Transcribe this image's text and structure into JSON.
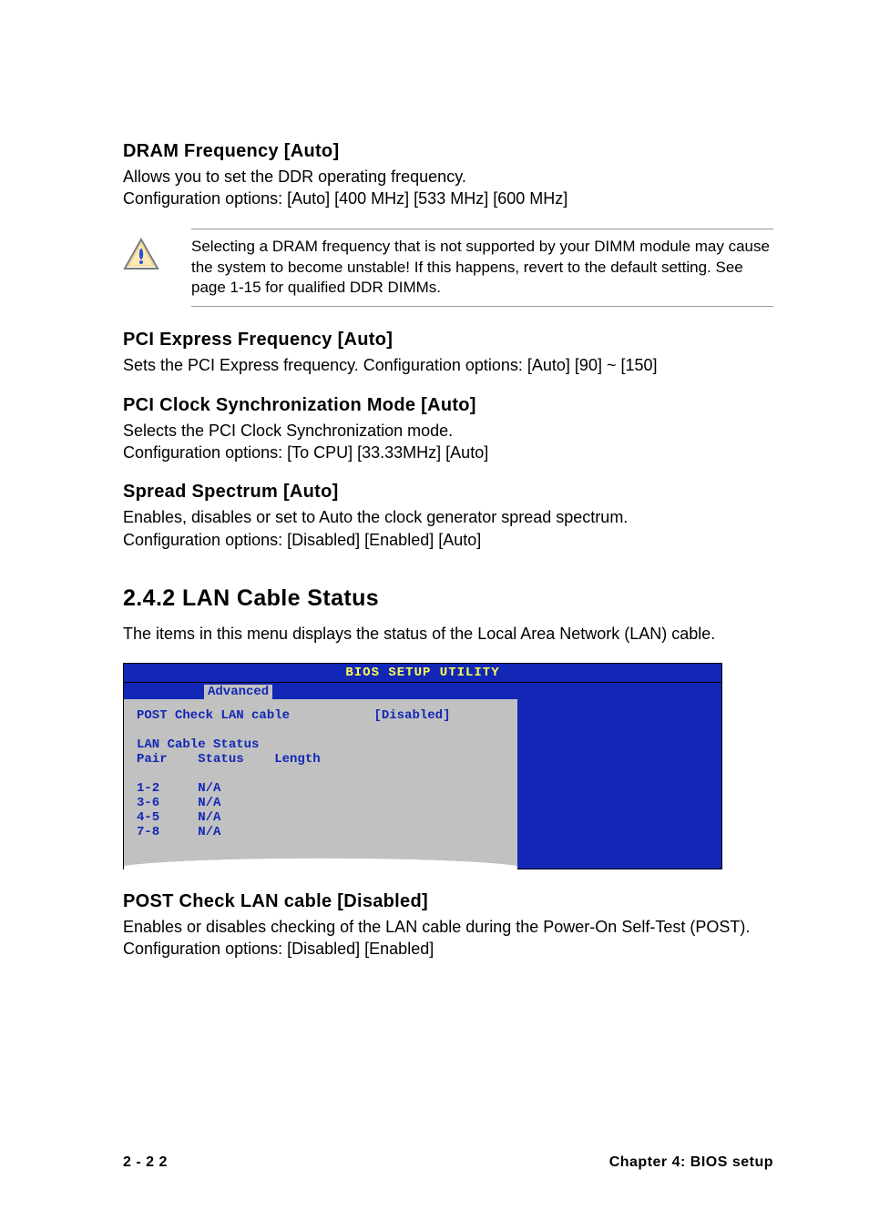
{
  "sections": {
    "dram": {
      "heading": "DRAM Frequency [Auto]",
      "text": "Allows you to set the DDR operating frequency.\nConfiguration options: [Auto] [400 MHz] [533 MHz] [600 MHz]"
    },
    "note": "Selecting a DRAM frequency that is not supported by your DIMM module may cause the system to become unstable! If this happens, revert to the default setting. See page 1-15 for qualified DDR DIMMs.",
    "pci_express": {
      "heading": "PCI Express Frequency [Auto]",
      "text": "Sets the PCI Express frequency. Configuration options: [Auto] [90] ~ [150]"
    },
    "pci_clock": {
      "heading": "PCI Clock Synchronization Mode [Auto]",
      "text": "Selects the PCI Clock Synchronization mode.\nConfiguration options: [To CPU] [33.33MHz] [Auto]"
    },
    "spread": {
      "heading": "Spread Spectrum [Auto]",
      "text": "Enables, disables or set to Auto the clock generator spread spectrum.\nConfiguration options: [Disabled] [Enabled] [Auto]"
    },
    "lan_status": {
      "heading": "2.4.2   LAN Cable Status",
      "text": "The items in this menu displays the status of the Local Area Network (LAN) cable."
    },
    "post_check": {
      "heading": "POST Check LAN cable [Disabled]",
      "text": "Enables or disables checking of the LAN cable during the Power-On Self-Test (POST). Configuration options: [Disabled] [Enabled]"
    }
  },
  "bios": {
    "title": "BIOS SETUP UTILITY",
    "tab": "Advanced",
    "row1_label": "POST Check LAN cable",
    "row1_value": "[Disabled]",
    "status_header": "LAN Cable Status",
    "table_header": "Pair    Status    Length",
    "rows": [
      {
        "pair": "1-2",
        "status": "N/A"
      },
      {
        "pair": "3-6",
        "status": "N/A"
      },
      {
        "pair": "4-5",
        "status": "N/A"
      },
      {
        "pair": "7-8",
        "status": "N/A"
      }
    ]
  },
  "footer": {
    "left": "2 - 2 2",
    "right": "Chapter 4: BIOS setup"
  }
}
